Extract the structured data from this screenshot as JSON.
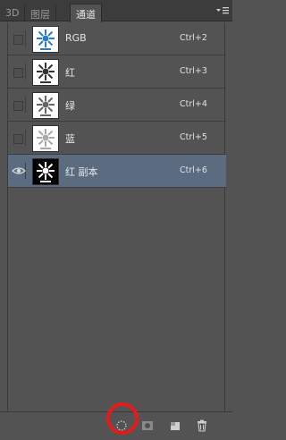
{
  "tabs": [
    {
      "label": "3D",
      "active": false
    },
    {
      "label": "图层",
      "active": false
    },
    {
      "label": "通道",
      "active": true
    }
  ],
  "panel_menu_icon": "panel-menu-icon",
  "channels": [
    {
      "name": "RGB",
      "shortcut": "Ctrl+2",
      "visible": false,
      "selected": false,
      "thumb": "color"
    },
    {
      "name": "红",
      "shortcut": "Ctrl+3",
      "visible": false,
      "selected": false,
      "thumb": "gray-dark"
    },
    {
      "name": "绿",
      "shortcut": "Ctrl+4",
      "visible": false,
      "selected": false,
      "thumb": "gray-mid"
    },
    {
      "name": "蓝",
      "shortcut": "Ctrl+5",
      "visible": false,
      "selected": false,
      "thumb": "gray-light"
    },
    {
      "name": "红 副本",
      "shortcut": "Ctrl+6",
      "visible": true,
      "selected": true,
      "thumb": "inverted"
    }
  ],
  "toolbar": {
    "buttons": [
      {
        "icon": "load-channel-as-selection-icon",
        "highlighted": true
      },
      {
        "icon": "save-selection-as-channel-icon"
      },
      {
        "icon": "new-channel-icon"
      },
      {
        "icon": "delete-channel-icon"
      }
    ]
  },
  "colors": {
    "panel_bg": "#535353",
    "selected_row": "#5b6b80",
    "highlight_ring": "#e51a1a"
  }
}
